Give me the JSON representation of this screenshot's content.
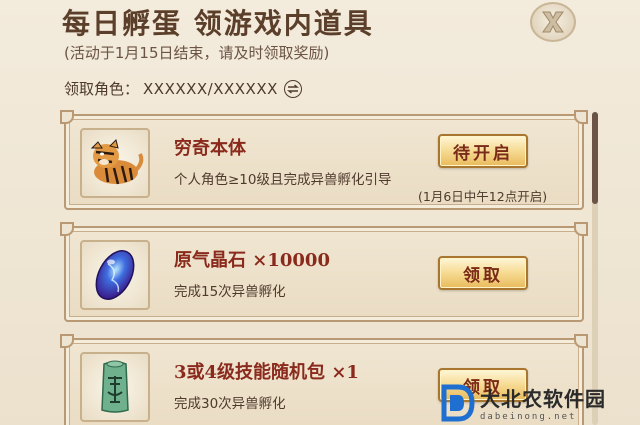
{
  "header": {
    "title": "每日孵蛋 领游戏内道具",
    "subtitle": "(活动于1月15日结束，请及时领取奖励)",
    "close_icon": "close-x-icon"
  },
  "role": {
    "label": "领取角色：",
    "value": "XXXXXX/XXXXXX",
    "switch_icon": "switch-arrows-icon"
  },
  "rewards": [
    {
      "name": "穷奇本体",
      "desc": "个人角色≥10级且完成异兽孵化引导",
      "button": "待开启",
      "note": "(1月6日中午12点开启)",
      "icon": "tiger-beast-icon"
    },
    {
      "name": "原气晶石 ×10000",
      "desc": "完成15次异兽孵化",
      "button": "领取",
      "icon": "blue-crystal-icon"
    },
    {
      "name": "3或4级技能随机包 ×1",
      "desc": "完成30次异兽孵化",
      "button": "领取",
      "icon": "jade-seal-icon"
    }
  ],
  "scroll": {
    "position": 0
  },
  "watermark": {
    "text_cn": "大北农软件园",
    "text_en": "dabeinong.net"
  },
  "colors": {
    "background": "#eee4d2",
    "title": "#5b3f2a",
    "item_name": "#8a2a1c",
    "button_gold": "#f7dd98",
    "border": "#b99874"
  }
}
